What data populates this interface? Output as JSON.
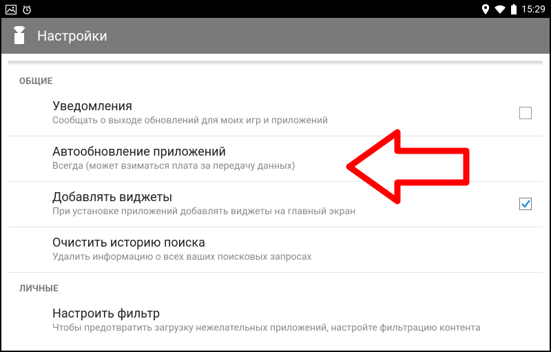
{
  "status_bar": {
    "time": "15:29"
  },
  "action_bar": {
    "title": "Настройки"
  },
  "sections": {
    "general": {
      "header": "ОБЩИЕ"
    },
    "personal": {
      "header": "ЛИЧНЫЕ"
    }
  },
  "items": {
    "notifications": {
      "title": "Уведомления",
      "sub": "Сообщать о выходе обновлений для моих игр и приложений",
      "checked": false
    },
    "auto_update": {
      "title": "Автообновление приложений",
      "sub": "Всегда (может взиматься плата за передачу данных)"
    },
    "add_widgets": {
      "title": "Добавлять виджеты",
      "sub": "При установке приложений добавлять виджеты на главный экран",
      "checked": true
    },
    "clear_history": {
      "title": "Очистить историю поиска",
      "sub": "Удалить информацию о всех ваших поисковых запросах"
    },
    "filter": {
      "title": "Настроить фильтр",
      "sub": "Чтобы предотвратить загрузку нежелательных приложений, настройте фильтрацию контента"
    }
  }
}
